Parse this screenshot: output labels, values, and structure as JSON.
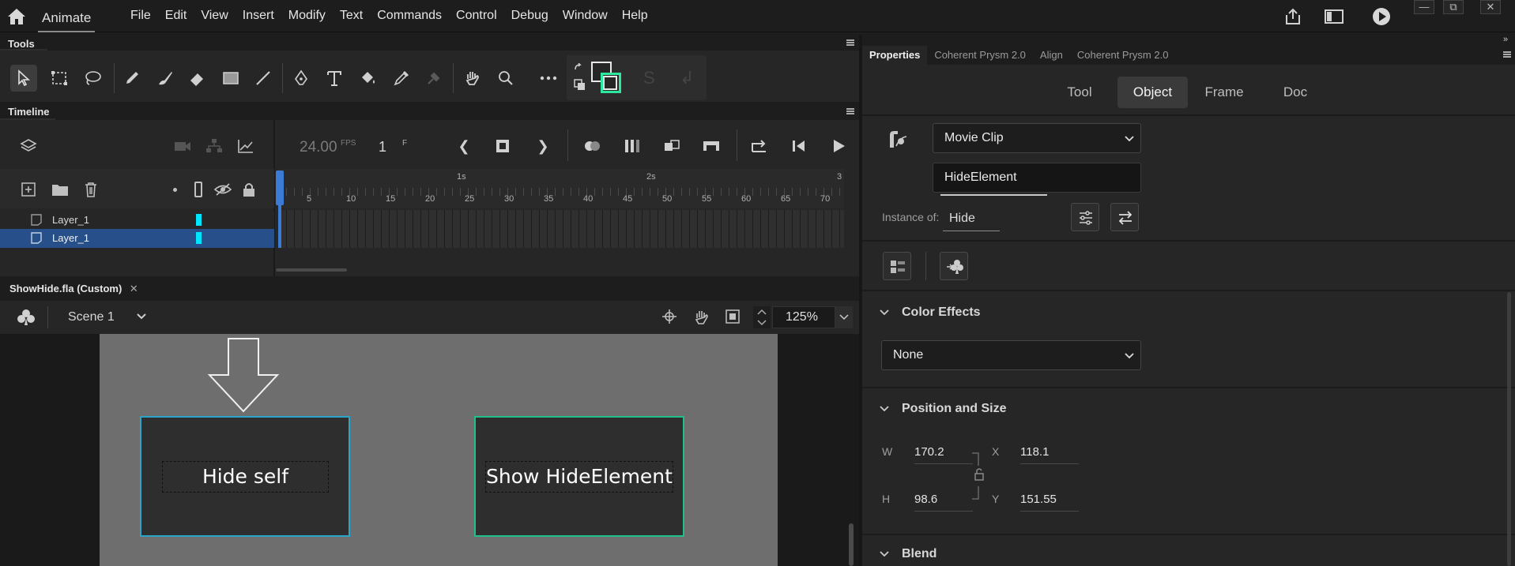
{
  "app": {
    "name": "Animate"
  },
  "menu": [
    "File",
    "Edit",
    "View",
    "Insert",
    "Modify",
    "Text",
    "Commands",
    "Control",
    "Debug",
    "Window",
    "Help"
  ],
  "tools_panel": {
    "title": "Tools"
  },
  "timeline": {
    "title": "Timeline",
    "fps": "24.00",
    "fps_unit": "FPS",
    "frame": "1",
    "frame_unit": "F",
    "ruler_seconds": [
      "1s",
      "2s",
      "3"
    ],
    "ruler_frames": [
      "5",
      "10",
      "15",
      "20",
      "25",
      "30",
      "35",
      "40",
      "45",
      "50",
      "55",
      "60",
      "65",
      "70"
    ],
    "layers": [
      {
        "name": "Layer_1",
        "selected": false,
        "color": "#00e5ff"
      },
      {
        "name": "Layer_1",
        "selected": true,
        "color": "#00e5ff"
      }
    ]
  },
  "document": {
    "tab": "ShowHide.fla (Custom)",
    "scene": "Scene 1",
    "zoom": "125%",
    "buttons": [
      {
        "label": "Hide self",
        "border": "#2aa5c7"
      },
      {
        "label": "Show HideElement",
        "border": "#21c08a"
      }
    ]
  },
  "properties": {
    "tabs": [
      "Properties",
      "Coherent Prysm 2.0",
      "Align",
      "Coherent Prysm 2.0"
    ],
    "subtabs": [
      "Tool",
      "Object",
      "Frame",
      "Doc"
    ],
    "active_subtab": "Object",
    "symbol_type": "Movie Clip",
    "instance_name": "HideElement",
    "instance_of_label": "Instance of:",
    "instance_of": "Hide",
    "color_effects": {
      "title": "Color Effects",
      "value": "None"
    },
    "position_size": {
      "title": "Position and Size",
      "w_label": "W",
      "w": "170.2",
      "h_label": "H",
      "h": "98.6",
      "x_label": "X",
      "x": "118.1",
      "y_label": "Y",
      "y": "151.55"
    },
    "blend": {
      "title": "Blend"
    }
  }
}
